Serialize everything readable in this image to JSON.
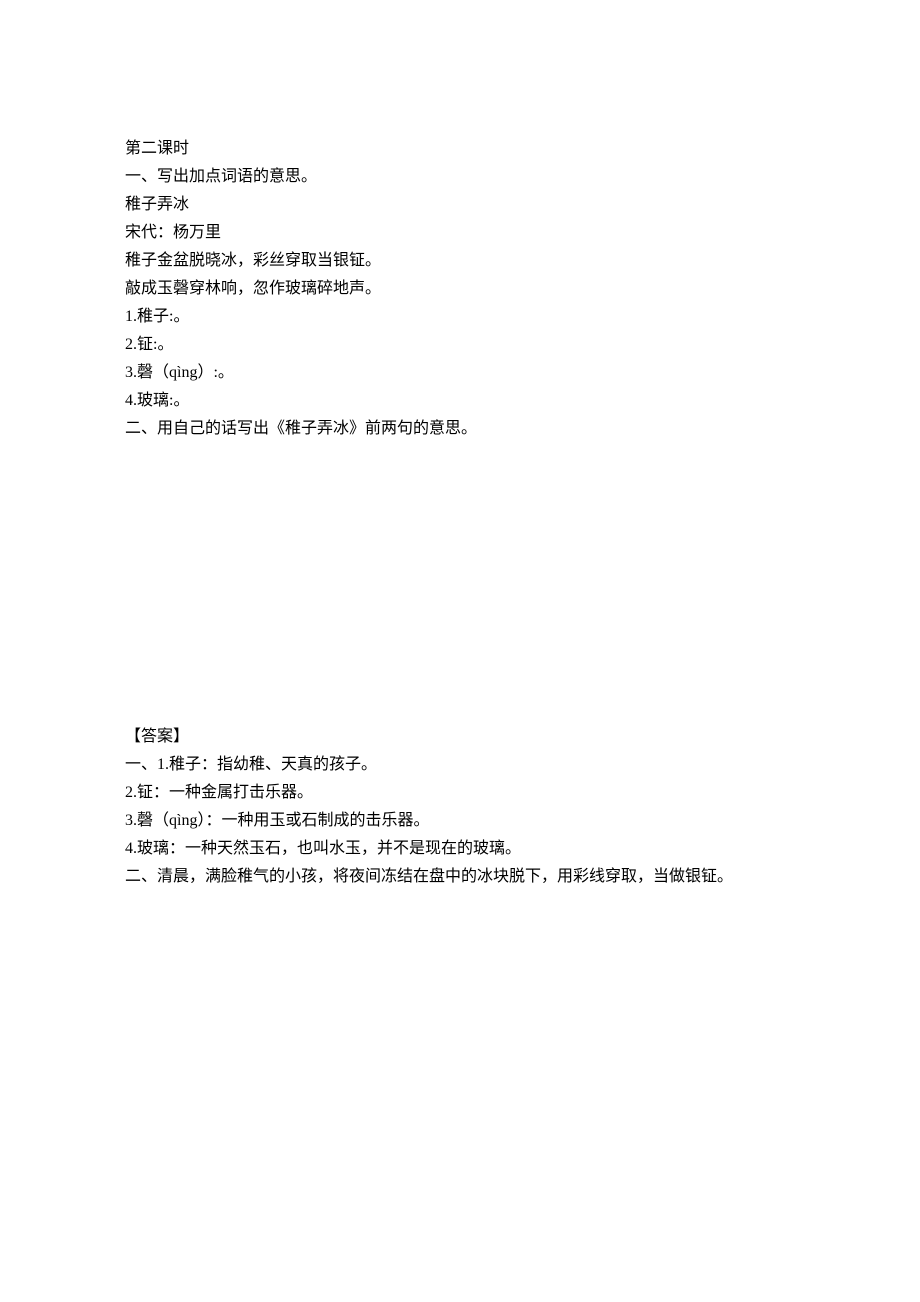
{
  "lesson": {
    "title": "第二课时",
    "section1_heading": "一、写出加点词语的意思。",
    "poem": {
      "title": "稚子弄冰",
      "dynasty_author": "宋代：杨万里",
      "line1": "稚子金盆脱晓冰，彩丝穿取当银钲。",
      "line2": "敲成玉磬穿林响，忽作玻璃碎地声。"
    },
    "questions": {
      "q1": "1.稚子:。",
      "q2": "2.钲:。",
      "q3": "3.磬（qìng）:。",
      "q4": "4.玻璃:。"
    },
    "section2_heading": "二、用自己的话写出《稚子弄冰》前两句的意思。",
    "answers": {
      "label": "【答案】",
      "a1": "一、1.稚子：指幼稚、天真的孩子。",
      "a2": "2.钲：一种金属打击乐器。",
      "a3": "3.磬（qìng）：一种用玉或石制成的击乐器。",
      "a4": "4.玻璃：一种天然玉石，也叫水玉，并不是现在的玻璃。",
      "a5": "二、清晨，满脸稚气的小孩，将夜间冻结在盘中的冰块脱下，用彩线穿取，当做银钲。"
    }
  }
}
